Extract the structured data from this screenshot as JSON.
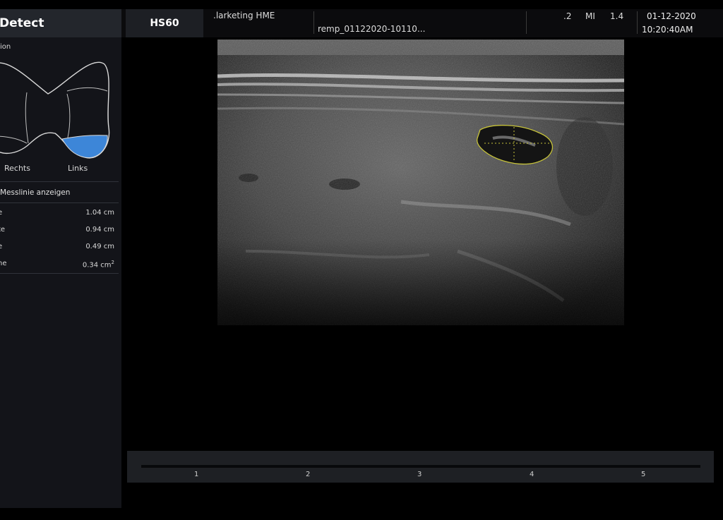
{
  "header": {
    "app_title": "Detect",
    "model": "HS60",
    "facility": ".larketing HME",
    "patient_id": "remp_01122020-10110...",
    "metrics": [
      {
        "label": ".2"
      },
      {
        "label": "MI"
      },
      {
        "label": "1.4"
      }
    ],
    "date": "01-12-2020",
    "time": "10:20:40AM"
  },
  "panel": {
    "section_label": "ion",
    "lobe_right": "Rechts",
    "lobe_left": "Links",
    "highlight_color": "#3d86d8",
    "toggle_label": "Messlinie anzeigen",
    "measurements": [
      {
        "label": "e",
        "value": "1.04 cm"
      },
      {
        "label": "te",
        "value": "0.94 cm"
      },
      {
        "label": "e",
        "value": "0.49 cm"
      },
      {
        "label": "he",
        "value": "0.34 cm",
        "unit_sup": "2"
      }
    ]
  },
  "scale": {
    "ticks": [
      "1",
      "2",
      "3",
      "4",
      "5"
    ]
  }
}
